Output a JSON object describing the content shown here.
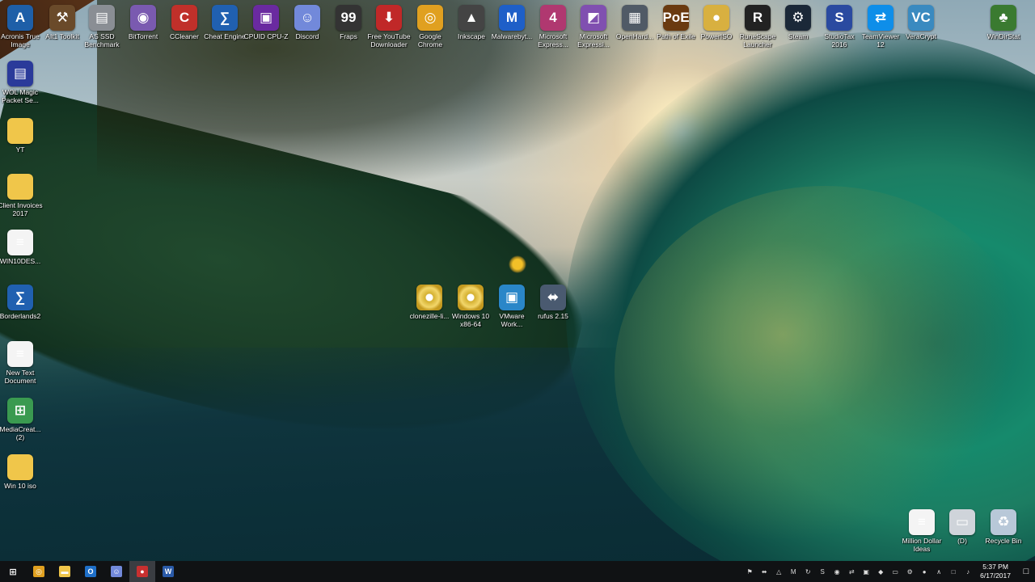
{
  "desktop": {
    "top_row": [
      {
        "label": "Acronis True Image",
        "icon": "acronis-icon",
        "glyph": "A",
        "color": "#1e5fa8"
      },
      {
        "label": "AIt1 Toolkit",
        "icon": "aio-toolkit-icon",
        "glyph": "⚒",
        "color": "#6a4a2a"
      },
      {
        "label": "AS SSD Benchmark",
        "icon": "ssd-benchmark-icon",
        "glyph": "▤",
        "color": "#8a8e94"
      },
      {
        "label": "BitTorrent",
        "icon": "bittorrent-icon",
        "glyph": "◉",
        "color": "#7a5ab0"
      },
      {
        "label": "CCleaner",
        "icon": "ccleaner-icon",
        "glyph": "C",
        "color": "#c0302a"
      },
      {
        "label": "Cheat Engine",
        "icon": "cheat-engine-icon",
        "glyph": "∑",
        "color": "#2060b0"
      },
      {
        "label": "CPUID CPU-Z",
        "icon": "cpuz-icon",
        "glyph": "▣",
        "color": "#6a2aa0"
      },
      {
        "label": "Discord",
        "icon": "discord-icon",
        "glyph": "☺",
        "color": "#7289da"
      },
      {
        "label": "Fraps",
        "icon": "fraps-icon",
        "glyph": "99",
        "color": "#333333"
      },
      {
        "label": "Free YouTube Downloader",
        "icon": "youtube-downloader-icon",
        "glyph": "⬇",
        "color": "#c02828"
      },
      {
        "label": "Google Chrome",
        "icon": "chrome-icon",
        "glyph": "◎",
        "color": "#e0a020"
      },
      {
        "label": "Inkscape",
        "icon": "inkscape-icon",
        "glyph": "▲",
        "color": "#444444"
      },
      {
        "label": "Malwarebyt...",
        "icon": "malwarebytes-icon",
        "glyph": "M",
        "color": "#1e5fc8"
      },
      {
        "label": "Microsoft Express...",
        "icon": "ms-expression-icon",
        "glyph": "4",
        "color": "#b03870"
      },
      {
        "label": "Microsoft Expressi...",
        "icon": "ms-expression-design-icon",
        "glyph": "◩",
        "color": "#8050b0"
      },
      {
        "label": "OpenHard...",
        "icon": "openhardware-icon",
        "glyph": "▦",
        "color": "#505a66"
      },
      {
        "label": "Path of Exile",
        "icon": "path-of-exile-icon",
        "glyph": "PoE",
        "color": "#6a3a10"
      },
      {
        "label": "PowerISO",
        "icon": "poweriso-icon",
        "glyph": "●",
        "color": "#d8b040"
      },
      {
        "label": "RuneScape Launcher",
        "icon": "runescape-icon",
        "glyph": "R",
        "color": "#222222"
      },
      {
        "label": "Steam",
        "icon": "steam-icon",
        "glyph": "⚙",
        "color": "#1b2838"
      },
      {
        "label": "StudioTax 2016",
        "icon": "studiotax-icon",
        "glyph": "S",
        "color": "#2a4aa0"
      },
      {
        "label": "TeamViewer 12",
        "icon": "teamviewer-icon",
        "glyph": "⇄",
        "color": "#0e8ee9"
      },
      {
        "label": "VeraCrypt",
        "icon": "veracrypt-icon",
        "glyph": "VC",
        "color": "#3a8ac0"
      },
      {
        "label": "WinDirStat",
        "icon": "windirstat-icon",
        "glyph": "♣",
        "color": "#3a7a30"
      }
    ],
    "left_column": [
      {
        "label": "WOL Magic Packet Se...",
        "icon": "wol-magic-packet-icon",
        "glyph": "▤",
        "color": "#2a3a9a"
      },
      {
        "label": "YT",
        "icon": "folder-icon",
        "glyph": "",
        "color": "#f0c64a"
      },
      {
        "label": "Client Invoices 2017",
        "icon": "folder-icon",
        "glyph": "",
        "color": "#f0c64a"
      },
      {
        "label": "WIN10DES...",
        "icon": "text-document-icon",
        "glyph": "≡",
        "color": "#f4f4f4"
      },
      {
        "label": "Borderlands2",
        "icon": "borderlands-icon",
        "glyph": "∑",
        "color": "#2060b0"
      },
      {
        "label": "New Text Document",
        "icon": "text-document-icon",
        "glyph": "≡",
        "color": "#f4f4f4"
      },
      {
        "label": "MediaCreat... (2)",
        "icon": "media-creation-tool-icon",
        "glyph": "⊞",
        "color": "#3a9a50"
      },
      {
        "label": "Win 10 iso",
        "icon": "folder-icon",
        "glyph": "",
        "color": "#f0c64a"
      }
    ],
    "middle_row": [
      {
        "label": "clonezille-li...",
        "icon": "disc-image-icon",
        "glyph": "",
        "color": "#d8b040"
      },
      {
        "label": "Windows 10 x86-64",
        "icon": "disc-image-icon",
        "glyph": "",
        "color": "#d8b040"
      },
      {
        "label": "VMware Work...",
        "icon": "vmware-icon",
        "glyph": "▣",
        "color": "#2a86c8"
      },
      {
        "label": "rufus 2.15",
        "icon": "rufus-usb-icon",
        "glyph": "⬌",
        "color": "#4a5a70"
      }
    ],
    "bottom_right": [
      {
        "label": "Million Dollar Ideas",
        "icon": "text-document-icon",
        "glyph": "≡",
        "color": "#f4f4f4"
      },
      {
        "label": "(D)",
        "icon": "drive-icon",
        "glyph": "▭",
        "color": "#cfd4da"
      },
      {
        "label": "Recycle Bin",
        "icon": "recycle-bin-icon",
        "glyph": "♻",
        "color": "#b8c8d8"
      }
    ]
  },
  "taskbar": {
    "start_glyph": "⊞",
    "pinned": [
      {
        "name": "chrome",
        "icon": "chrome-icon",
        "glyph": "◎",
        "color": "#e0a020"
      },
      {
        "name": "file-explorer",
        "icon": "folder-icon",
        "glyph": "▬",
        "color": "#f0c64a"
      },
      {
        "name": "outlook",
        "icon": "outlook-icon",
        "glyph": "O",
        "color": "#1e6fc8"
      },
      {
        "name": "discord",
        "icon": "discord-icon",
        "glyph": "☺",
        "color": "#7289da"
      },
      {
        "name": "recorder",
        "icon": "recorder-icon",
        "glyph": "●",
        "color": "#c83030"
      },
      {
        "name": "word",
        "icon": "word-icon",
        "glyph": "W",
        "color": "#2a5aa8"
      }
    ],
    "tray": [
      {
        "icon": "flag-icon",
        "glyph": "⚑"
      },
      {
        "icon": "usb-icon",
        "glyph": "⬌"
      },
      {
        "icon": "arrow-icon",
        "glyph": "△"
      },
      {
        "icon": "malwarebytes-tray-icon",
        "glyph": "M"
      },
      {
        "icon": "sync-icon",
        "glyph": "↻"
      },
      {
        "icon": "skype-icon",
        "glyph": "S"
      },
      {
        "icon": "gamepad-icon",
        "glyph": "◉"
      },
      {
        "icon": "teamviewer-tray-icon",
        "glyph": "⇄"
      },
      {
        "icon": "monitor-icon",
        "glyph": "▣"
      },
      {
        "icon": "shield-icon",
        "glyph": "◆"
      },
      {
        "icon": "battery-icon",
        "glyph": "▭"
      },
      {
        "icon": "gear-icon",
        "glyph": "⚙"
      },
      {
        "icon": "steam-tray-icon",
        "glyph": "●"
      },
      {
        "icon": "chevron-up-icon",
        "glyph": "∧"
      },
      {
        "icon": "network-icon",
        "glyph": "□"
      },
      {
        "icon": "volume-icon",
        "glyph": "♪"
      }
    ],
    "time": "5:37 PM",
    "date": "6/17/2017"
  }
}
